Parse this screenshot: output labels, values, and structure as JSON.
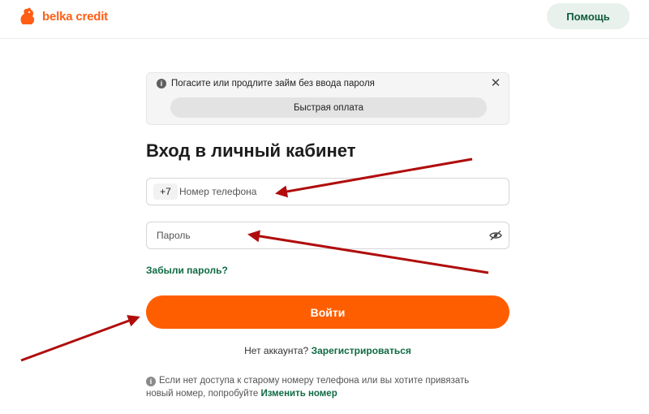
{
  "header": {
    "logo_text": "belka credit",
    "help_label": "Помощь"
  },
  "notice": {
    "info_text": "Погасите или продлите займ без ввода пароля",
    "close_symbol": "✕",
    "quick_pay_label": "Быстрая оплата"
  },
  "form": {
    "title": "Вход в личный кабинет",
    "phone_prefix": "+7",
    "phone_placeholder": "Номер телефона",
    "phone_value": "",
    "password_placeholder": "Пароль",
    "password_value": "",
    "forgot_label": "Забыли пароль?",
    "login_label": "Войти",
    "no_account_text": "Нет аккаунта?",
    "register_label": "Зарегистрироваться"
  },
  "footnote": {
    "text_line1": "Если нет доступа к старому номеру телефона или вы хотите привязать",
    "text_line2": "новый номер, попробуйте",
    "change_label": "Изменить номер"
  },
  "colors": {
    "brand_orange": "#ff5e00",
    "link_green": "#0f6b44",
    "help_bg": "#e8f1ec",
    "arrow_red": "#b00c0c"
  },
  "icons": {
    "logo": "squirrel-logo-icon",
    "info": "info-icon",
    "close": "close-icon",
    "eye": "eye-off-icon"
  }
}
